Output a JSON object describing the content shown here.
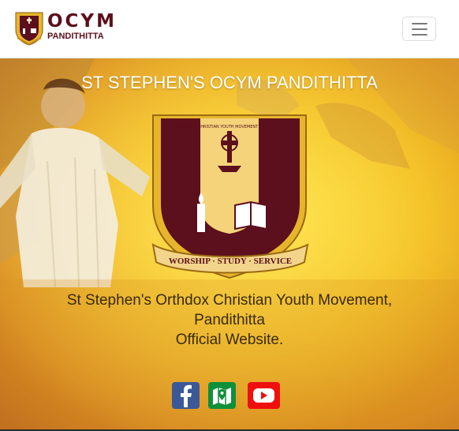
{
  "navbar": {
    "brand_title": "OCYM",
    "brand_subtitle": "PANDITHITTA",
    "toggler_icon": "hamburger-menu-icon"
  },
  "hero": {
    "title": "ST STEPHEN'S OCYM PANDITHITTA",
    "emblem": {
      "ring_text": "ORTHODOX CHRISTIAN YOUTH MOVEMENT OF THE EAST",
      "motto": "WORSHIP · STUDY · SERVICE"
    },
    "description": [
      "St Stephen's Orthdox Christian Youth Movement,",
      "Pandithitta",
      "Official Website."
    ]
  },
  "socials": [
    {
      "name": "facebook",
      "icon": "facebook-icon",
      "color": "#3b5998"
    },
    {
      "name": "map",
      "icon": "map-location-icon",
      "color": "#0f8f3a"
    },
    {
      "name": "youtube",
      "icon": "youtube-icon",
      "color": "#ee0f0f"
    }
  ],
  "colors": {
    "brand_maroon": "#5c0f1c",
    "hero_gold": "#f4c01d",
    "shield_gold": "#e7b52b"
  }
}
